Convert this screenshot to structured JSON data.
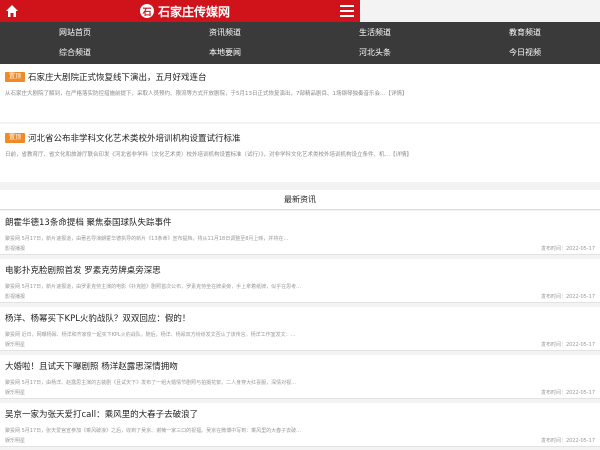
{
  "header": {
    "site_name": "石家庄传媒网",
    "logo_mark": "石"
  },
  "nav": [
    "网站首页",
    "资讯频道",
    "生活频道",
    "教育频道",
    "综合频道",
    "本地要闻",
    "河北头条",
    "今日视频"
  ],
  "featured": [
    {
      "tag": "置顶",
      "title": "石家庄大剧院正式恢复线下演出，五月好戏连台",
      "desc": "从石家庄大剧院了解到，在严格落实防控措施前提下，采取人员预约、限流等方式开放剧院，于5月13日正式恢复演出，7部精品剧目、1场钢琴独奏音乐会…【详情】"
    },
    {
      "tag": "置顶",
      "title": "河北省公布非学科文化艺术类校外培训机构设置试行标准",
      "desc": "日前，省教育厅、省文化和旅游厅联合印发《河北省非学科（文化艺术类）校外培训机构设置标准（试行）》，对非学科文化艺术类校外培训机构设立条件、机…【详情】"
    }
  ],
  "latest_title": "最新资讯",
  "articles": [
    {
      "title": "朗霍华德13条命提档 聚焦泰国球队失踪事件",
      "summary": "聚投网 5月17日，新片速报道，由著名导演朗霍华德执导的新片《13条命》宣布提档，将从11月18日调整至8月上映，并将在…",
      "source": "影视播报",
      "date": "发布时间：2022-05-17"
    },
    {
      "title": "电影扑克脸剧照首发 罗素克劳牌桌旁深思",
      "summary": "聚投网 5月17日，新片速报道，由罗素克劳主演的电影《扑克脸》剧照首次公布，罗素克劳坐在牌桌旁，手上拿着纸牌，似乎在思考…",
      "source": "影视播报",
      "date": "发布时间：2022-05-17"
    },
    {
      "title": "杨洋、杨幂买下KPL火豹战队？双双回应：假的！",
      "summary": "聚投网 近日，网曝杨幂、杨洋和齐家俊一起买下KPL火豹战队。随后，杨洋、杨幂双方纷纷发文否认了该传言。杨洋工作室发文：…",
      "source": "娱乐明星",
      "date": "发布时间：2022-05-17"
    },
    {
      "title": "大婚啦！且试天下曝剧照 杨洋赵露思深情拥吻",
      "summary": "聚投网 5月17日，由杨洋、赵露思主演的古装剧《且试天下》发布了一组大婚情节剧照与拍摄花絮。二人身穿大红喜服，深情对视…",
      "source": "娱乐明星",
      "date": "发布时间：2022-05-17"
    },
    {
      "title": "吴京一家为张天爱打call：乘风里的大春子去破浪了",
      "summary": "聚投网 5月17日，张天爱官宣参加《乘风破浪》之后，收到了吴京、谢楠一家三口的祝福。吴京在微博中写到：乘风里的大春子去破…",
      "source": "娱乐明星",
      "date": "发布时间：2022-05-17"
    }
  ]
}
